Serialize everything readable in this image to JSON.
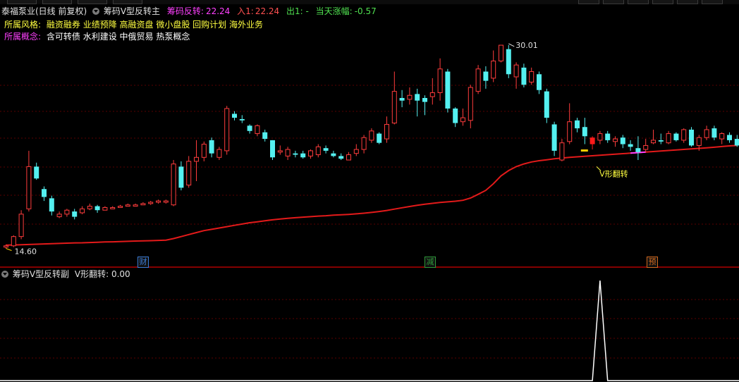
{
  "header": {
    "stock_title": "泰福泵业(日线 前复权)",
    "indicator_name": "筹码V型反转主",
    "signal_label": "筹码反转:",
    "signal_value": "22.24",
    "entry_label": "入1:",
    "entry_value": "22.24",
    "exit_label": "出1: -",
    "change_label": "当天涨幅:",
    "change_value": "-0.57"
  },
  "style_row": {
    "label": "所属风格:",
    "value": "融资融券 业绩预降 高融资盘 微小盘股 回购计划 海外业务"
  },
  "concept_row": {
    "label": "所属概念:",
    "value": "含可转债 水利建设 中俄贸易 热泵概念"
  },
  "annotations": {
    "high_price": "30.01",
    "low_price": "14.60",
    "v_reversal": "V形翻转"
  },
  "axis_markers": [
    {
      "text": "财",
      "color": "#3a7bd5"
    },
    {
      "text": "减",
      "color": "#2e9a3a"
    },
    {
      "text": "预",
      "color": "#d2691e"
    }
  ],
  "sub_panel": {
    "indicator_name": "筹码V型反转副",
    "value_label": "V形翻转: 0.00"
  },
  "colors": {
    "up": "#ff3c3c",
    "down": "#54f0f0",
    "ma": "#e31a1a",
    "signal_bar": "#ff1a1a",
    "grid": "#5a0000"
  },
  "chart_data": {
    "type": "candlestick",
    "candles": [
      [
        14.7,
        14.8,
        14.9,
        14.6
      ],
      [
        14.8,
        15.5,
        15.6,
        14.7
      ],
      [
        15.5,
        17.2,
        17.5,
        15.3
      ],
      [
        17.6,
        20.8,
        22.0,
        17.4
      ],
      [
        20.8,
        19.9,
        21.1,
        19.8
      ],
      [
        19.1,
        18.5,
        19.3,
        18.2
      ],
      [
        18.4,
        17.4,
        18.6,
        17.1
      ],
      [
        17.0,
        17.2,
        17.4,
        16.9
      ],
      [
        17.2,
        17.5,
        17.6,
        17.0
      ],
      [
        17.4,
        17.0,
        17.6,
        16.8
      ],
      [
        17.3,
        17.6,
        17.8,
        17.2
      ],
      [
        17.6,
        17.8,
        18.0,
        17.5
      ],
      [
        17.8,
        17.5,
        17.9,
        17.3
      ],
      [
        17.5,
        17.7,
        17.8,
        17.5
      ],
      [
        17.6,
        17.7,
        17.8,
        17.6
      ],
      [
        17.7,
        17.8,
        17.9,
        17.7
      ],
      [
        17.8,
        17.9,
        18.0,
        17.8
      ],
      [
        17.8,
        17.9,
        18.0,
        17.8
      ],
      [
        17.9,
        18.0,
        18.1,
        17.9
      ],
      [
        18.0,
        18.1,
        18.2,
        17.9
      ],
      [
        18.1,
        18.2,
        18.3,
        18.0
      ],
      [
        18.1,
        18.2,
        18.3,
        18.0
      ],
      [
        17.9,
        21.0,
        21.3,
        17.8
      ],
      [
        20.8,
        19.2,
        21.2,
        19.0
      ],
      [
        19.4,
        21.2,
        21.6,
        19.2
      ],
      [
        21.2,
        21.5,
        22.8,
        19.7
      ],
      [
        21.5,
        22.5,
        22.7,
        21.2
      ],
      [
        22.8,
        21.8,
        23.0,
        21.5
      ],
      [
        21.5,
        22.1,
        22.3,
        21.3
      ],
      [
        22.0,
        25.2,
        25.4,
        21.7
      ],
      [
        24.8,
        24.5,
        25.0,
        24.3
      ],
      [
        24.4,
        24.3,
        24.7,
        24.1
      ],
      [
        23.9,
        23.5,
        24.0,
        23.3
      ],
      [
        23.3,
        23.9,
        24.0,
        23.1
      ],
      [
        23.4,
        22.9,
        23.6,
        22.7
      ],
      [
        22.8,
        21.5,
        22.8,
        21.3
      ],
      [
        21.9,
        22.0,
        22.4,
        21.7
      ],
      [
        21.6,
        22.1,
        22.3,
        21.3
      ],
      [
        21.8,
        21.7,
        22.0,
        21.5
      ],
      [
        21.8,
        21.5,
        22.0,
        21.4
      ],
      [
        21.6,
        22.0,
        22.1,
        21.4
      ],
      [
        21.7,
        22.3,
        22.5,
        21.5
      ],
      [
        22.2,
        22.0,
        22.4,
        21.8
      ],
      [
        21.8,
        21.6,
        22.0,
        21.5
      ],
      [
        21.6,
        21.4,
        21.8,
        21.3
      ],
      [
        21.3,
        21.7,
        21.9,
        21.3
      ],
      [
        21.8,
        22.1,
        22.5,
        21.6
      ],
      [
        22.1,
        23.0,
        23.2,
        21.8
      ],
      [
        22.8,
        23.5,
        23.7,
        22.6
      ],
      [
        23.3,
        22.6,
        23.4,
        22.5
      ],
      [
        22.9,
        24.0,
        24.6,
        22.6
      ],
      [
        24.1,
        26.5,
        28.0,
        24.0
      ],
      [
        26.0,
        25.8,
        26.6,
        25.3
      ],
      [
        25.9,
        26.2,
        26.8,
        25.5
      ],
      [
        26.3,
        25.8,
        26.7,
        24.6
      ],
      [
        26.0,
        25.7,
        26.2,
        24.7
      ],
      [
        26.1,
        26.4,
        27.5,
        25.5
      ],
      [
        26.4,
        28.2,
        29.0,
        25.8
      ],
      [
        28.0,
        25.2,
        28.2,
        24.9
      ],
      [
        25.2,
        24.1,
        25.3,
        23.8
      ],
      [
        24.2,
        24.5,
        25.2,
        23.9
      ],
      [
        24.3,
        26.8,
        27.0,
        23.7
      ],
      [
        26.5,
        28.2,
        28.5,
        26.3
      ],
      [
        28.0,
        27.3,
        28.4,
        26.7
      ],
      [
        27.5,
        28.8,
        29.6,
        27.2
      ],
      [
        28.8,
        30.0,
        30.0,
        28.7
      ],
      [
        29.7,
        27.8,
        30.01,
        27.5
      ],
      [
        27.6,
        28.5,
        28.7,
        26.7
      ],
      [
        28.3,
        27.0,
        28.6,
        26.8
      ],
      [
        27.2,
        28.0,
        28.3,
        27.0
      ],
      [
        27.8,
        26.6,
        28.0,
        26.3
      ],
      [
        26.5,
        24.5,
        26.7,
        24.1
      ],
      [
        24.0,
        22.0,
        24.2,
        21.6
      ],
      [
        21.3,
        22.6,
        22.9,
        21.2
      ],
      [
        22.7,
        24.2,
        25.6,
        22.5
      ],
      [
        24.3,
        23.7,
        24.5,
        23.4
      ],
      [
        23.8,
        23.1,
        24.5,
        22.5
      ],
      [
        23.0,
        22.5,
        23.1,
        22.1
      ],
      [
        22.8,
        23.3,
        23.5,
        22.5
      ],
      [
        23.3,
        22.8,
        23.5,
        22.6
      ],
      [
        22.7,
        22.9,
        23.1,
        22.3
      ],
      [
        23.0,
        22.5,
        23.2,
        22.2
      ],
      [
        22.5,
        22.3,
        22.8,
        22.0
      ],
      [
        22.2,
        21.9,
        23.1,
        21.3
      ],
      [
        22.1,
        22.4,
        22.9,
        21.9
      ],
      [
        22.6,
        22.8,
        23.6,
        22.5
      ],
      [
        22.8,
        22.7,
        23.3,
        22.5
      ],
      [
        22.6,
        23.3,
        23.5,
        22.5
      ],
      [
        23.3,
        22.8,
        23.4,
        22.7
      ],
      [
        22.8,
        23.6,
        23.7,
        22.6
      ],
      [
        23.6,
        22.4,
        23.8,
        22.3
      ],
      [
        22.4,
        23.0,
        23.2,
        22.0
      ],
      [
        23.0,
        23.6,
        23.9,
        22.8
      ],
      [
        23.7,
        23.0,
        23.9,
        22.8
      ],
      [
        22.9,
        23.3,
        23.4,
        22.5
      ],
      [
        23.2,
        22.8,
        23.4,
        22.6
      ],
      [
        22.9,
        22.4,
        23.2,
        22.3
      ]
    ],
    "ma": [
      14.85,
      14.86,
      14.88,
      14.9,
      14.92,
      14.94,
      14.96,
      14.98,
      15.0,
      15.02,
      15.03,
      15.05,
      15.07,
      15.09,
      15.1,
      15.12,
      15.14,
      15.16,
      15.17,
      15.19,
      15.21,
      15.23,
      15.35,
      15.5,
      15.65,
      15.8,
      15.95,
      16.05,
      16.15,
      16.25,
      16.35,
      16.45,
      16.55,
      16.62,
      16.7,
      16.77,
      16.83,
      16.88,
      16.93,
      16.97,
      17.01,
      17.05,
      17.08,
      17.12,
      17.15,
      17.18,
      17.22,
      17.27,
      17.33,
      17.4,
      17.48,
      17.58,
      17.68,
      17.78,
      17.87,
      17.95,
      18.02,
      18.08,
      18.13,
      18.18,
      18.25,
      18.42,
      18.7,
      19.0,
      19.5,
      20.1,
      20.5,
      20.8,
      21.0,
      21.15,
      21.25,
      21.32,
      21.4,
      21.45,
      21.5,
      21.54,
      21.58,
      21.62,
      21.66,
      21.7,
      21.74,
      21.78,
      21.82,
      21.86,
      21.9,
      21.94,
      21.98,
      22.02,
      22.06,
      22.1,
      22.14,
      22.18,
      22.22,
      22.27,
      22.32,
      22.37,
      22.4
    ],
    "signal_index": 77,
    "ylim": [
      14.2,
      31.5
    ],
    "sub_series": {
      "type": "line",
      "peak_index": 78,
      "value": 1,
      "ylim": [
        0,
        1
      ]
    }
  }
}
